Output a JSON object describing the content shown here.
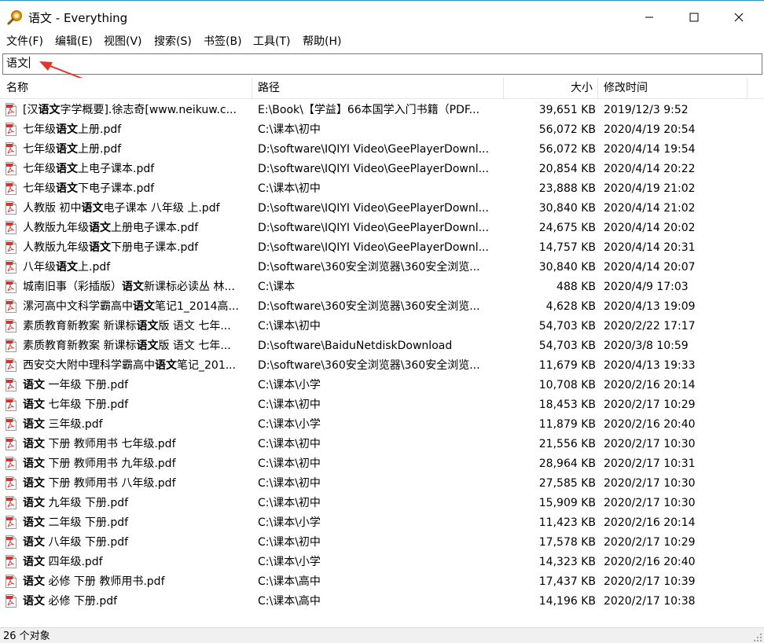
{
  "window": {
    "title": "语文 - Everything"
  },
  "menu": [
    {
      "label": "文件(F)"
    },
    {
      "label": "编辑(E)"
    },
    {
      "label": "视图(V)"
    },
    {
      "label": "搜索(S)"
    },
    {
      "label": "书签(B)"
    },
    {
      "label": "工具(T)"
    },
    {
      "label": "帮助(H)"
    }
  ],
  "search": {
    "value": "语文"
  },
  "columns": {
    "name": "名称",
    "path": "路径",
    "size": "大小",
    "modified": "修改时间"
  },
  "icons": {
    "app": "magnifier-icon",
    "file": "pdf-file-icon"
  },
  "accent": {
    "arrow": "#e8322a",
    "pdf": "#d9302c"
  },
  "files": [
    {
      "pre": "[汉",
      "hl": "语文",
      "post": "字学概要].徐志奇[www.neikuw.c...",
      "path": "E:\\Book\\【学益】66本国学入门书籍（PDF...",
      "size": "39,651 KB",
      "modified": "2019/12/3 9:52"
    },
    {
      "pre": "七年级",
      "hl": "语文",
      "post": "上册.pdf",
      "path": "C:\\课本\\初中",
      "size": "56,072 KB",
      "modified": "2020/4/19 20:54"
    },
    {
      "pre": "七年级",
      "hl": "语文",
      "post": "上册.pdf",
      "path": "D:\\software\\IQIYI Video\\GeePlayerDownl...",
      "size": "56,072 KB",
      "modified": "2020/4/14 19:54"
    },
    {
      "pre": "七年级",
      "hl": "语文",
      "post": "上电子课本.pdf",
      "path": "D:\\software\\IQIYI Video\\GeePlayerDownl...",
      "size": "20,854 KB",
      "modified": "2020/4/14 20:22"
    },
    {
      "pre": "七年级",
      "hl": "语文",
      "post": "下电子课本.pdf",
      "path": "C:\\课本\\初中",
      "size": "23,888 KB",
      "modified": "2020/4/19 21:02"
    },
    {
      "pre": "人教版 初中",
      "hl": "语文",
      "post": "电子课本 八年级 上.pdf",
      "path": "D:\\software\\IQIYI Video\\GeePlayerDownl...",
      "size": "30,840 KB",
      "modified": "2020/4/14 21:02"
    },
    {
      "pre": "人教版九年级",
      "hl": "语文",
      "post": "上册电子课本.pdf",
      "path": "D:\\software\\IQIYI Video\\GeePlayerDownl...",
      "size": "24,675 KB",
      "modified": "2020/4/14 20:02"
    },
    {
      "pre": "人教版九年级",
      "hl": "语文",
      "post": "下册电子课本.pdf",
      "path": "D:\\software\\IQIYI Video\\GeePlayerDownl...",
      "size": "14,757 KB",
      "modified": "2020/4/14 20:31"
    },
    {
      "pre": "八年级",
      "hl": "语文",
      "post": "上.pdf",
      "path": "D:\\software\\360安全浏览器\\360安全浏览...",
      "size": "30,840 KB",
      "modified": "2020/4/14 20:07"
    },
    {
      "pre": "城南旧事（彩插版）",
      "hl": "语文",
      "post": "新课标必读丛 林...",
      "path": "C:\\课本",
      "size": "488 KB",
      "modified": "2020/4/9 17:03"
    },
    {
      "pre": "漯河高中文科学霸高中",
      "hl": "语文",
      "post": "笔记1_2014高...",
      "path": "D:\\software\\360安全浏览器\\360安全浏览...",
      "size": "4,628 KB",
      "modified": "2020/4/13 19:09"
    },
    {
      "pre": "素质教育新教案 新课标",
      "hl": "语文",
      "post": "版 语文 七年...",
      "path": "C:\\课本\\初中",
      "size": "54,703 KB",
      "modified": "2020/2/22 17:17"
    },
    {
      "pre": "素质教育新教案 新课标",
      "hl": "语文",
      "post": "版 语文 七年...",
      "path": "D:\\software\\BaiduNetdiskDownload",
      "size": "54,703 KB",
      "modified": "2020/3/8 10:59"
    },
    {
      "pre": "西安交大附中理科学霸高中",
      "hl": "语文",
      "post": "笔记_201...",
      "path": "D:\\software\\360安全浏览器\\360安全浏览...",
      "size": "11,679 KB",
      "modified": "2020/4/13 19:33"
    },
    {
      "pre": "",
      "hl": "语文",
      "post": " 一年级 下册.pdf",
      "path": "C:\\课本\\小学",
      "size": "10,708 KB",
      "modified": "2020/2/16 20:14"
    },
    {
      "pre": "",
      "hl": "语文",
      "post": " 七年级 下册.pdf",
      "path": "C:\\课本\\初中",
      "size": "18,453 KB",
      "modified": "2020/2/17 10:29"
    },
    {
      "pre": "",
      "hl": "语文",
      "post": " 三年级.pdf",
      "path": "C:\\课本\\小学",
      "size": "11,879 KB",
      "modified": "2020/2/16 20:40"
    },
    {
      "pre": "",
      "hl": "语文",
      "post": " 下册 教师用书 七年级.pdf",
      "path": "C:\\课本\\初中",
      "size": "21,556 KB",
      "modified": "2020/2/17 10:30"
    },
    {
      "pre": "",
      "hl": "语文",
      "post": " 下册 教师用书 九年级.pdf",
      "path": "C:\\课本\\初中",
      "size": "28,964 KB",
      "modified": "2020/2/17 10:31"
    },
    {
      "pre": "",
      "hl": "语文",
      "post": " 下册 教师用书 八年级.pdf",
      "path": "C:\\课本\\初中",
      "size": "27,585 KB",
      "modified": "2020/2/17 10:30"
    },
    {
      "pre": "",
      "hl": "语文",
      "post": " 九年级 下册.pdf",
      "path": "C:\\课本\\初中",
      "size": "15,909 KB",
      "modified": "2020/2/17 10:30"
    },
    {
      "pre": "",
      "hl": "语文",
      "post": " 二年级 下册.pdf",
      "path": "C:\\课本\\小学",
      "size": "11,423 KB",
      "modified": "2020/2/16 20:14"
    },
    {
      "pre": "",
      "hl": "语文",
      "post": " 八年级 下册.pdf",
      "path": "C:\\课本\\初中",
      "size": "17,578 KB",
      "modified": "2020/2/17 10:29"
    },
    {
      "pre": "",
      "hl": "语文",
      "post": " 四年级.pdf",
      "path": "C:\\课本\\小学",
      "size": "14,323 KB",
      "modified": "2020/2/16 20:40"
    },
    {
      "pre": "",
      "hl": "语文",
      "post": " 必修 下册 教师用书.pdf",
      "path": "C:\\课本\\高中",
      "size": "17,437 KB",
      "modified": "2020/2/17 10:39"
    },
    {
      "pre": "",
      "hl": "语文",
      "post": " 必修 下册.pdf",
      "path": "C:\\课本\\高中",
      "size": "14,196 KB",
      "modified": "2020/2/17 10:38"
    }
  ],
  "status": {
    "count": "26 个对象"
  }
}
